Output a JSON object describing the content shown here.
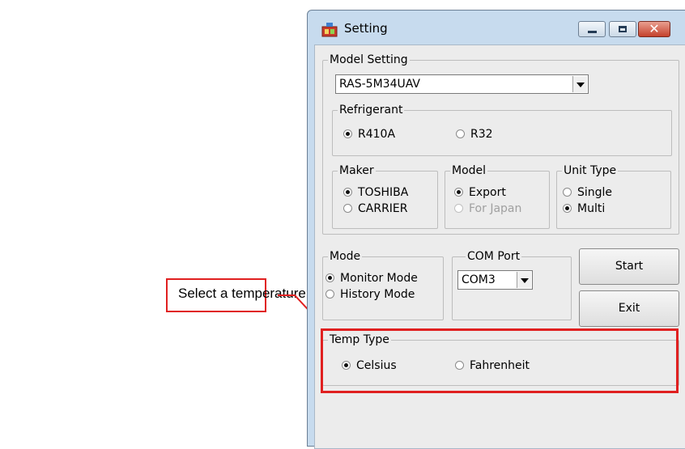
{
  "window": {
    "title": "Setting"
  },
  "model_setting": {
    "label": "Model Setting",
    "selected": "RAS-5M34UAV"
  },
  "refrigerant": {
    "label": "Refrigerant",
    "options": [
      {
        "label": "R410A",
        "checked": true
      },
      {
        "label": "R32",
        "checked": false
      }
    ]
  },
  "maker": {
    "label": "Maker",
    "options": [
      {
        "label": "TOSHIBA",
        "checked": true
      },
      {
        "label": "CARRIER",
        "checked": false
      }
    ]
  },
  "model": {
    "label": "Model",
    "options": [
      {
        "label": "Export",
        "checked": true
      },
      {
        "label": "For Japan",
        "checked": false,
        "disabled": true
      }
    ]
  },
  "unit_type": {
    "label": "Unit Type",
    "options": [
      {
        "label": "Single",
        "checked": false
      },
      {
        "label": "Multi",
        "checked": true
      }
    ]
  },
  "mode": {
    "label": "Mode",
    "options": [
      {
        "label": "Monitor Mode",
        "checked": true
      },
      {
        "label": "History Mode",
        "checked": false
      }
    ]
  },
  "com_port": {
    "label": "COM Port",
    "selected": "COM3"
  },
  "buttons": {
    "start": "Start",
    "exit": "Exit"
  },
  "temp_type": {
    "label": "Temp Type",
    "options": [
      {
        "label": "Celsius",
        "checked": true
      },
      {
        "label": "Fahrenheit",
        "checked": false
      }
    ]
  },
  "annotation": {
    "text": "Select a temperature unit",
    "color": "#e02020"
  }
}
